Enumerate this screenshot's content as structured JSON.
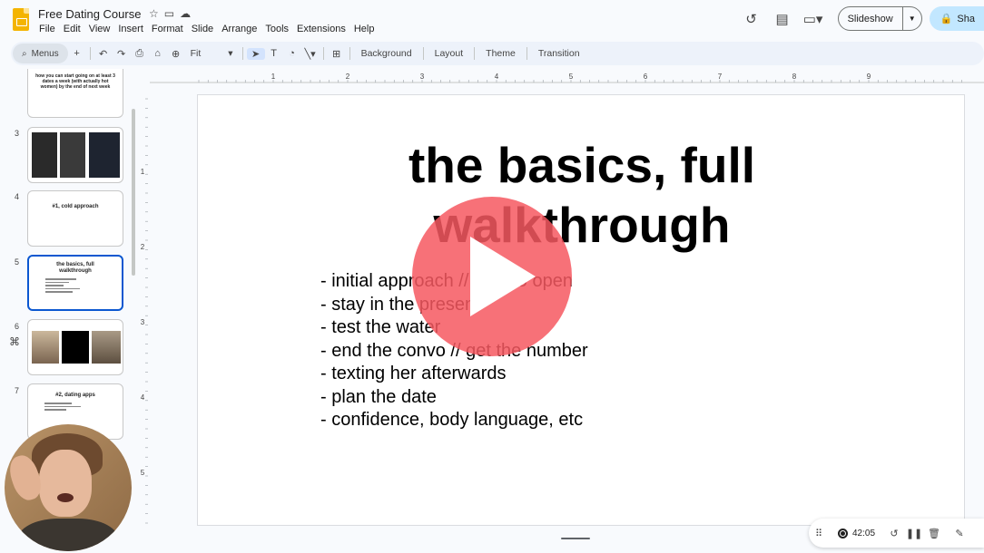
{
  "app": {
    "doc_title": "Free Dating Course",
    "menu": [
      "File",
      "Edit",
      "View",
      "Insert",
      "Format",
      "Slide",
      "Arrange",
      "Tools",
      "Extensions",
      "Help"
    ],
    "slideshow_label": "Slideshow",
    "share_label": "Sha"
  },
  "toolbar": {
    "menus_label": "Menus",
    "zoom_label": "Fit",
    "background_label": "Background",
    "layout_label": "Layout",
    "theme_label": "Theme",
    "transition_label": "Transition"
  },
  "filmstrip": {
    "slide2_title": "how you can start going on at least 3 dates a week (with actually hot women) by the end of next week",
    "slides": [
      {
        "num": "3"
      },
      {
        "num": "4",
        "title": "#1, cold approach"
      },
      {
        "num": "5",
        "title": "the basics, full walkthrough"
      },
      {
        "num": "6"
      },
      {
        "num": "7",
        "title": "#2, dating apps"
      }
    ]
  },
  "ruler": {
    "h": [
      "1",
      "2",
      "3",
      "4",
      "5",
      "6",
      "7",
      "8",
      "9"
    ],
    "v": [
      "1",
      "2",
      "3",
      "4",
      "5"
    ]
  },
  "slide": {
    "title_line1": "the basics, full",
    "title_line2": "walkthrough",
    "bullets": [
      "- initial approach // how to open",
      "- stay in the present",
      "- test the water",
      "- end the convo // get the number",
      "- texting her afterwards",
      "- plan the date",
      "- confidence, body language, etc"
    ]
  },
  "recorder": {
    "time": "42:05"
  },
  "icons": [
    "star-icon",
    "move-to-folder-icon",
    "cloud-status-icon",
    "history-icon",
    "comment-icon",
    "video-call-icon",
    "lock-icon",
    "search-icon",
    "plus-icon",
    "undo-icon",
    "redo-icon",
    "print-icon",
    "paint-format-icon",
    "zoom-icon",
    "select-cursor-icon",
    "text-box-icon",
    "shape-icon",
    "line-icon",
    "add-comment-icon",
    "play-icon",
    "drag-handle-icon",
    "restart-icon",
    "pause-icon",
    "delete-icon",
    "pen-icon"
  ]
}
